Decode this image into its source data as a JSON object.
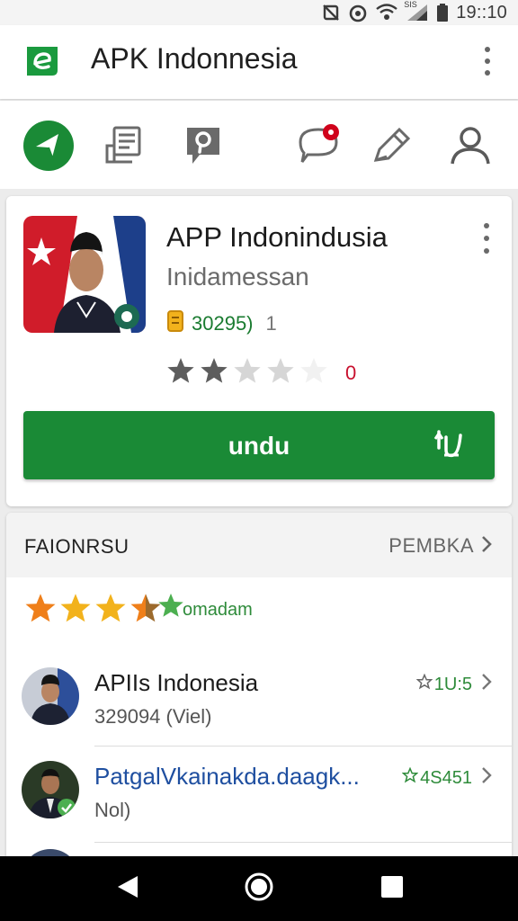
{
  "status_bar": {
    "time": "19::10",
    "sim_label": "SIS"
  },
  "app_bar": {
    "title": "APK Indonnesia"
  },
  "tabs": [
    {
      "name": "tab-home",
      "icon": "compass-arrow-icon"
    },
    {
      "name": "tab-articles",
      "icon": "document-icon"
    },
    {
      "name": "tab-location",
      "icon": "location-pin-icon"
    },
    {
      "name": "tab-messages",
      "icon": "chat-bubble-icon"
    },
    {
      "name": "tab-edit",
      "icon": "pencil-icon"
    },
    {
      "name": "tab-profile",
      "icon": "person-icon"
    }
  ],
  "app_card": {
    "title": "APP Indonindusia",
    "subtitle": "Inidamessan",
    "meta_value": "30295)",
    "meta_extra": "1",
    "rating_filled": 2,
    "rating_total": 5,
    "rating_count": "0",
    "download_label": "undu"
  },
  "section": {
    "title": "FAIONRSU",
    "more_label": "PEMBKA",
    "rating_value": 4.5,
    "rating_label": "omadam",
    "items": [
      {
        "title": "APIIs Indonesia",
        "subtitle": "329094 (Viel)",
        "score": "1U:5"
      },
      {
        "title": "PatgalVkainakda.daagk...",
        "subtitle": "Nol)",
        "score": "4S451"
      }
    ]
  },
  "colors": {
    "accent_green": "#1a8a36",
    "title_blue": "#1f4fa0",
    "star_orange": "#ef7f1a",
    "star_gold": "#f2b21c",
    "star_green": "#4caf50",
    "badge_red": "#d0021b"
  }
}
